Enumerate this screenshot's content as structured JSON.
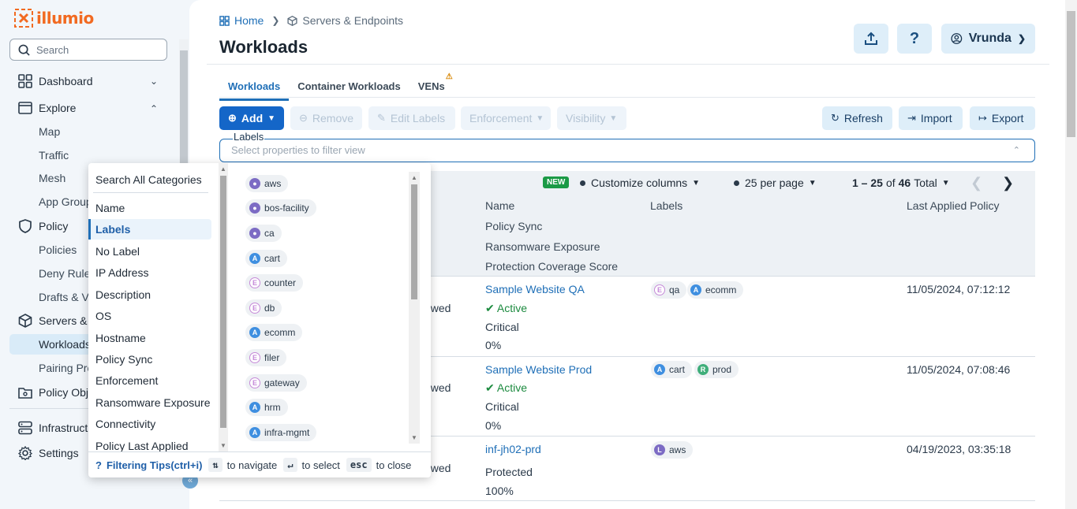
{
  "brand": {
    "name": "illumio",
    "color": "#f26a21"
  },
  "sidebar": {
    "search_placeholder": "Search",
    "sections": {
      "dashboard": "Dashboard",
      "explore": "Explore",
      "map": "Map",
      "traffic": "Traffic",
      "mesh": "Mesh",
      "app_group": "App Group",
      "policy": "Policy",
      "policies": "Policies",
      "deny_rules": "Deny Rule",
      "drafts": "Drafts & V",
      "servers": "Servers &",
      "workloads": "Workloads",
      "pairing": "Pairing Pro",
      "policy_objects": "Policy Obj",
      "infrastructure": "Infrastruct",
      "settings": "Settings"
    },
    "collapse_icon": "double-chevron-left-icon"
  },
  "breadcrumb": {
    "home": "Home",
    "current": "Servers & Endpoints"
  },
  "page": {
    "title": "Workloads"
  },
  "header": {
    "user": "Vrunda"
  },
  "tabs": [
    "Workloads",
    "Container Workloads",
    "VENs"
  ],
  "toolbar": {
    "add": "Add",
    "remove": "Remove",
    "edit_labels": "Edit Labels",
    "enforcement": "Enforcement",
    "visibility": "Visibility",
    "refresh": "Refresh",
    "import": "Import",
    "export": "Export"
  },
  "filter": {
    "legend": "Labels",
    "placeholder": "Select properties to filter view"
  },
  "table": {
    "new_badge": "NEW",
    "customize": "Customize columns",
    "per_page": "25 per page",
    "range": "1 – 25",
    "of": "of",
    "total_count": "46",
    "total_word": "Total",
    "columns": {
      "name": "Name",
      "policy_sync": "Policy Sync",
      "ransomware": "Ransomware Exposure",
      "coverage": "Protection Coverage Score",
      "labels": "Labels",
      "last_applied": "Last Applied Policy"
    },
    "rows": [
      {
        "left": "owed",
        "name": "Sample Website QA",
        "sync": "Active",
        "exposure": "Critical",
        "score": "0%",
        "labels": [
          {
            "icon": "E",
            "text": "qa"
          },
          {
            "icon": "A",
            "text": "ecomm"
          }
        ],
        "applied": "11/05/2024, 07:12:12"
      },
      {
        "left": "owed",
        "name": "Sample Website Prod",
        "sync": "Active",
        "exposure": "Critical",
        "score": "0%",
        "labels": [
          {
            "icon": "A",
            "text": "cart"
          },
          {
            "icon": "R",
            "text": "prod"
          }
        ],
        "applied": "11/05/2024, 07:08:46"
      },
      {
        "left": "owed",
        "name": "inf-jh02-prd",
        "sync": "",
        "exposure": "Protected",
        "score": "100%",
        "labels": [
          {
            "icon": "L",
            "text": "aws"
          }
        ],
        "applied": "04/19/2023, 03:35:18"
      }
    ]
  },
  "dropdown": {
    "search_all": "Search All Categories",
    "categories": [
      "Name",
      "Labels",
      "No Label",
      "IP Address",
      "Description",
      "OS",
      "Hostname",
      "Policy Sync",
      "Enforcement",
      "Ransomware Exposure",
      "Connectivity",
      "Policy Last Applied"
    ],
    "options": [
      {
        "type": "loc",
        "text": "aws"
      },
      {
        "type": "loc",
        "text": "bos-facility"
      },
      {
        "type": "loc",
        "text": "ca"
      },
      {
        "type": "app",
        "text": "cart"
      },
      {
        "type": "env",
        "text": "counter"
      },
      {
        "type": "env",
        "text": "db"
      },
      {
        "type": "app",
        "text": "ecomm"
      },
      {
        "type": "env",
        "text": "filer"
      },
      {
        "type": "env",
        "text": "gateway"
      },
      {
        "type": "app",
        "text": "hrm"
      },
      {
        "type": "app",
        "text": "infra-mgmt"
      }
    ],
    "footer": {
      "tips": "Filtering Tips(ctrl+i)",
      "navigate": "to navigate",
      "select_key": "↵",
      "select": "to select",
      "esc_key": "esc",
      "close": "to close"
    }
  },
  "colors": {
    "accent": "#1f6fb7",
    "primary_button": "#1466c8",
    "success": "#1b8a3e",
    "new_badge": "#1b9a46"
  }
}
